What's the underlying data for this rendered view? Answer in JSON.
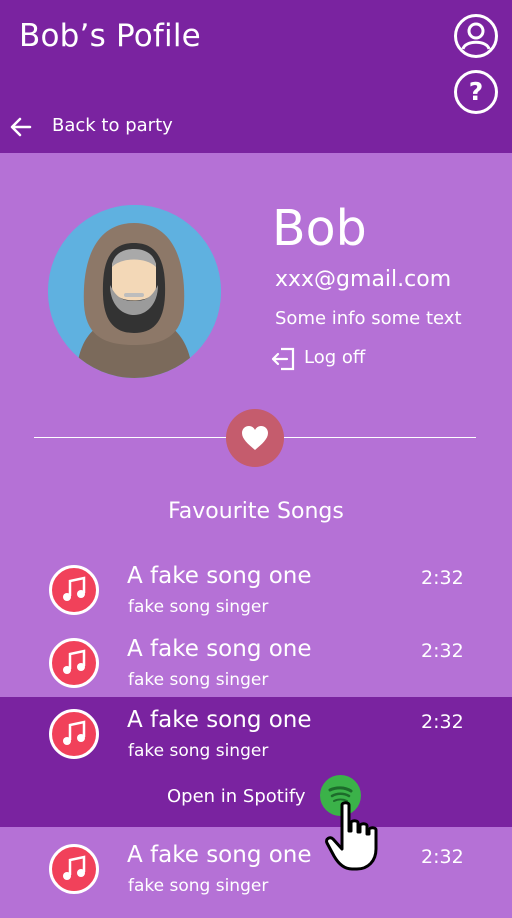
{
  "header": {
    "title": "Bob’s Pofile",
    "user_icon": "user-circle-icon",
    "help_icon": "help-circle-icon",
    "help_glyph": "?",
    "back_label": "Back to party"
  },
  "profile": {
    "name": "Bob",
    "email": "xxx@gmail.com",
    "info": "Some info some text",
    "logoff_label": "Log off"
  },
  "favourites": {
    "title": "Favourite Songs",
    "songs": [
      {
        "title": "A fake song one",
        "artist": "fake song singer",
        "duration": "2:32"
      },
      {
        "title": "A fake song one",
        "artist": "fake song singer",
        "duration": "2:32"
      },
      {
        "title": "A fake song one",
        "artist": "fake song singer",
        "duration": "2:32"
      },
      {
        "title": "A fake song one",
        "artist": "fake song singer",
        "duration": "2:32"
      }
    ],
    "spotify_label": "Open in Spotify"
  },
  "colors": {
    "background": "#b571d6",
    "header": "#7a23a0",
    "heart_badge": "#c55c6d",
    "note_icon": "#f1415a",
    "spotify": "#3bb249"
  }
}
